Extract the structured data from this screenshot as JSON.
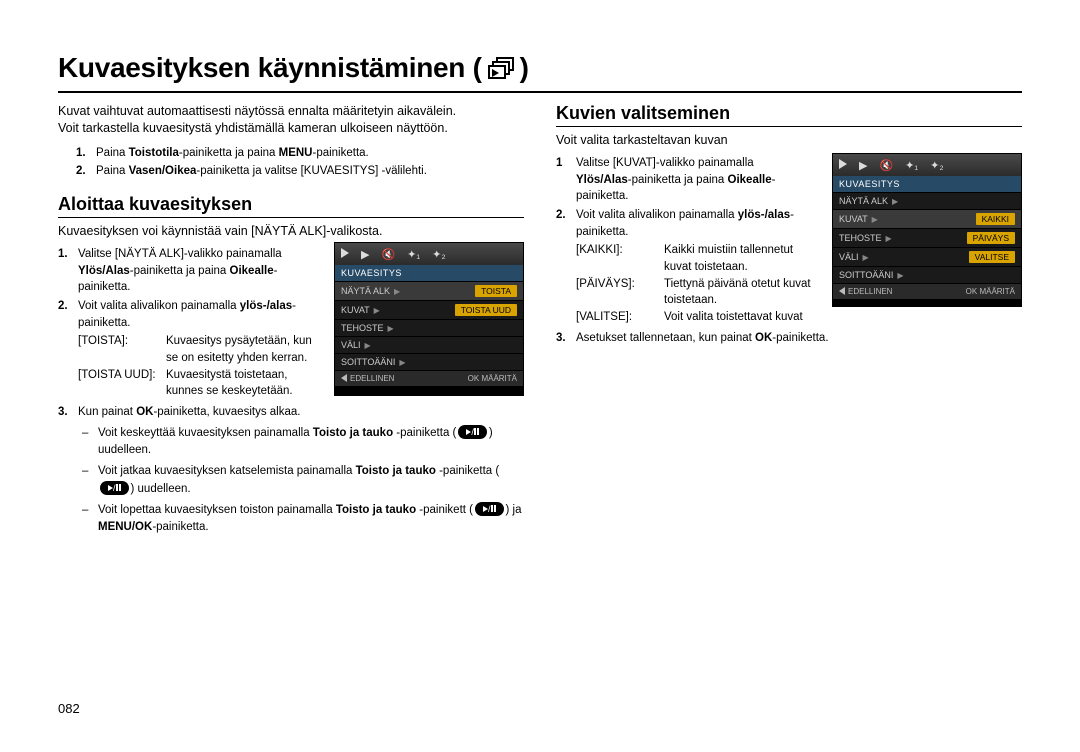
{
  "page_number": "082",
  "main_title_prefix": "Kuvaesityksen käynnistäminen (",
  "main_title_suffix": ")",
  "icon_name": "slideshow-icon",
  "intro_line1": "Kuvat vaihtuvat automaattisesti näytössä ennalta määritetyin aikavälein.",
  "intro_line2": "Voit tarkastella kuvaesitystä yhdistämällä kameran ulkoiseen näyttöön.",
  "prep_steps": [
    {
      "n": "1.",
      "pre": "Paina ",
      "b1": "Toistotila",
      "mid": "-painiketta ja paina ",
      "b2": "MENU",
      "post": "-painiketta."
    },
    {
      "n": "2.",
      "pre": "Paina ",
      "b1": "Vasen/Oikea",
      "mid": "-painiketta ja valitse [KUVAESITYS] -välilehti.",
      "b2": "",
      "post": ""
    }
  ],
  "left": {
    "title": "Aloittaa kuvaesityksen",
    "desc": "Kuvaesityksen voi käynnistää vain [NÄYTÄ ALK]-valikosta.",
    "steps": [
      {
        "n": "1.",
        "html": [
          "Valitse [NÄYTÄ ALK]-valikko painamalla ",
          {
            "b": "Ylös/Alas"
          },
          "-painiketta ja paina ",
          {
            "b": "Oikealle"
          },
          "-painiketta."
        ]
      },
      {
        "n": "2.",
        "html": [
          "Voit valita alivalikon painamalla ",
          {
            "b": "ylös-/alas"
          },
          "-painiketta."
        ]
      }
    ],
    "defs": [
      {
        "term": "[TOISTA]:",
        "def": "Kuvaesitys pysäytetään, kun se on esitetty yhden kerran."
      },
      {
        "term": "[TOISTA UUD]:",
        "def": "Kuvaesitystä toistetaan, kunnes se keskeytetään."
      }
    ],
    "step3_n": "3.",
    "step3_pre": "Kun painat ",
    "step3_b": "OK",
    "step3_post": "-painiketta, kuvaesitys alkaa.",
    "dash": [
      {
        "pre": "Voit keskeyttää kuvaesityksen painamalla ",
        "b": "Toisto ja tauko",
        "mid": " -painiketta (",
        "post": ") uudelleen."
      },
      {
        "pre": "Voit jatkaa kuvaesityksen katselemista painamalla ",
        "b": "Toisto ja tauko",
        "mid": " -painiketta (",
        "post": ") uudelleen."
      },
      {
        "pre": "Voit lopettaa kuvaesityksen toiston painamalla ",
        "b": "Toisto ja tauko",
        "mid": " -painikett (",
        "post": ") ja ",
        "b2": "MENU/OK",
        "post2": "-painiketta."
      }
    ],
    "lcd": {
      "header": "KUVAESITYS",
      "rows": [
        {
          "label": "NÄYTÄ ALK",
          "sel": true,
          "val": "TOISTA"
        },
        {
          "label": "KUVAT",
          "sel": false,
          "val": "TOISTA UUD"
        },
        {
          "label": "TEHOSTE",
          "sel": false
        },
        {
          "label": "VÄLI",
          "sel": false
        },
        {
          "label": "SOITTOÄÄNI",
          "sel": false
        }
      ],
      "footer_back": "EDELLINEN",
      "footer_ok": "OK",
      "footer_set": "MÄÄRITÄ"
    }
  },
  "right": {
    "title": "Kuvien valitseminen",
    "desc": "Voit valita tarkasteltavan kuvan",
    "steps": [
      {
        "n": "1",
        "html": [
          "Valitse [KUVAT]-valikko painamalla ",
          {
            "b": "Ylös/Alas"
          },
          "-painiketta ja paina ",
          {
            "b": "Oikealle"
          },
          "-painiketta."
        ]
      },
      {
        "n": "2.",
        "html": [
          "Voit valita alivalikon painamalla ",
          {
            "b": "ylös-/alas"
          },
          "-painiketta."
        ]
      }
    ],
    "defs": [
      {
        "term": "[KAIKKI]:",
        "def": "Kaikki muistiin tallennetut kuvat toistetaan."
      },
      {
        "term": "[PÄIVÄYS]:",
        "def": "Tiettynä päivänä otetut kuvat toistetaan."
      },
      {
        "term": "[VALITSE]:",
        "def": "Voit valita toistettavat kuvat"
      }
    ],
    "step3_n": "3.",
    "step3_pre": "Asetukset tallennetaan, kun painat ",
    "step3_b": "OK",
    "step3_post": "-painiketta.",
    "lcd": {
      "header": "KUVAESITYS",
      "rows": [
        {
          "label": "NÄYTÄ ALK",
          "sel": false
        },
        {
          "label": "KUVAT",
          "sel": true,
          "val": "KAIKKI"
        },
        {
          "label": "TEHOSTE",
          "sel": false,
          "val": "PÄIVÄYS"
        },
        {
          "label": "VÄLI",
          "sel": false,
          "val": "VALITSE"
        },
        {
          "label": "SOITTOÄÄNI",
          "sel": false
        }
      ],
      "footer_back": "EDELLINEN",
      "footer_ok": "OK",
      "footer_set": "MÄÄRITÄ"
    }
  }
}
